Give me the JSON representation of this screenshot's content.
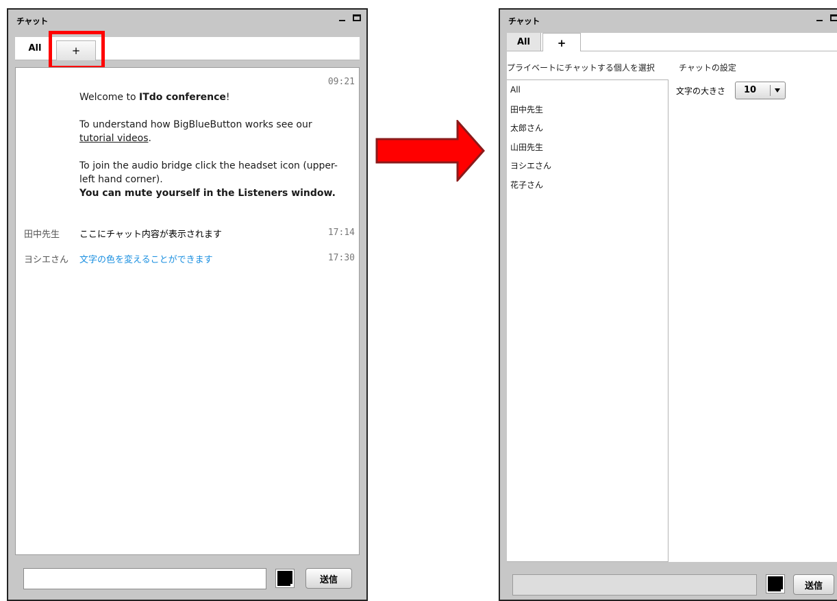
{
  "left_panel": {
    "title": "チャット",
    "tabs": {
      "all": "All",
      "plus": "+"
    },
    "welcome": {
      "time": "09:21",
      "line1_pre": "Welcome to ",
      "line1_bold": "ITdo conference",
      "line1_post": "!",
      "line2_pre": "To understand how BigBlueButton works see our ",
      "line2_link": "tutorial videos",
      "line2_post": ".",
      "line3": "To join the audio bridge click the headset icon (upper-left hand corner).",
      "line4_bold": "You can mute yourself in the Listeners window."
    },
    "messages": [
      {
        "sender": "田中先生",
        "text": "ここにチャット内容が表示されます",
        "time": "17:14",
        "color": "#000000"
      },
      {
        "sender": "ヨシエさん",
        "text": "文字の色を変えることができます",
        "time": "17:30",
        "color": "#1a8fe0"
      }
    ],
    "send_label": "送信",
    "text_color": "#000000"
  },
  "right_panel": {
    "title": "チャット",
    "tabs": {
      "all": "All",
      "plus": "+"
    },
    "private_chat_title": "プライベートにチャットする個人を選択",
    "users": [
      "All",
      "田中先生",
      "太郎さん",
      "山田先生",
      "ヨシエさん",
      "花子さん"
    ],
    "settings_title": "チャットの設定",
    "font_size_label": "文字の大きさ",
    "font_size_value": "10",
    "send_label": "送信"
  },
  "colors": {
    "arrow": "#ff0000",
    "highlight": "#ff0000",
    "panel_bg": "#c7c7c7"
  }
}
